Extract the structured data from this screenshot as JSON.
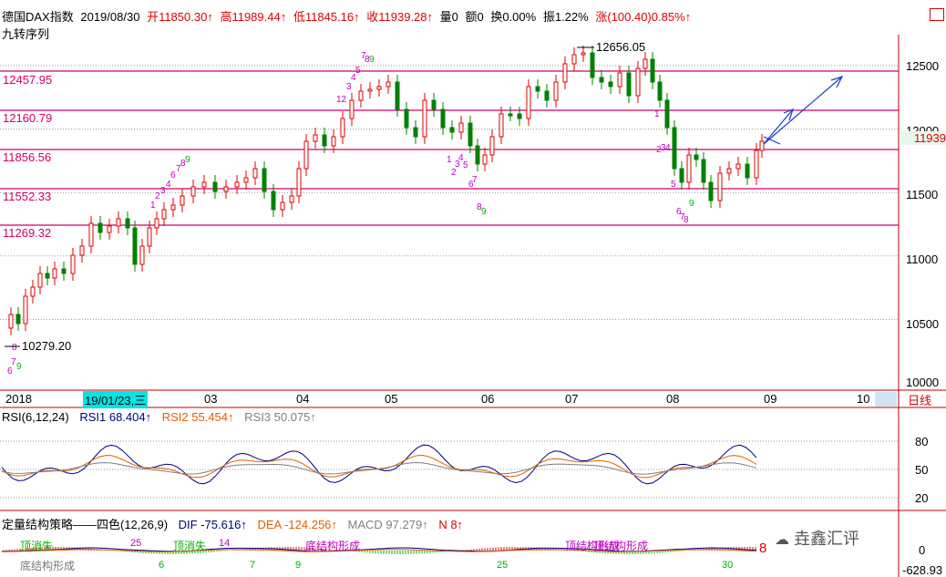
{
  "header": {
    "name": "德国DAX指数",
    "date": "2019/08/30",
    "open": "开11850.30↑",
    "high": "高11989.44↑",
    "low": "低11845.16↑",
    "close": "收11939.28↑",
    "vol": "量0",
    "amount": "额0",
    "turnover": "换0.00%",
    "amplitude": "振1.22%",
    "change": "涨(100.40)0.85%↑"
  },
  "subtitle": "九转序列",
  "level_labels": [
    "12457.95",
    "12160.79",
    "11856.56",
    "11552.33",
    "11269.32"
  ],
  "price_axis": [
    "12500",
    "12000",
    "11939",
    "11500",
    "11000",
    "10500",
    "10000"
  ],
  "annotations": {
    "high": "12656.05",
    "low": "10279.20"
  },
  "x_axis": [
    "2018",
    "03",
    "04",
    "05",
    "06",
    "07",
    "08",
    "09",
    "10"
  ],
  "cursor_date": "19/01/23,三",
  "period_button": "日线",
  "rsi": {
    "title": "RSI(6,12,24)",
    "rsi1": "RSI1 68.404↑",
    "rsi2": "RSI2 55.454↑",
    "rsi3": "RSI3 50.075↑",
    "axis": [
      "80",
      "50",
      "20"
    ]
  },
  "macd": {
    "title": "定量结构策略——四色(12,26,9)",
    "dif": "DIF -75.616↑",
    "dea": "DEA -124.256↑",
    "macd": "MACD 97.279↑",
    "n": "N 8↑",
    "axis": [
      "0",
      "-628.93"
    ],
    "labels": [
      "顶消失",
      "底结构形成",
      "顶消失",
      "底结构形成",
      "顶结构形成",
      "顶结构形成",
      "25",
      "6",
      "14",
      "7",
      "9",
      "25",
      "30",
      "8"
    ]
  },
  "watermark": "垚鑫汇评",
  "colors": {
    "up": "#e00000",
    "down": "#008000",
    "level": "#d0006a",
    "rsi1": "#000080",
    "rsi2": "#e06000",
    "rsi3": "#808080",
    "seq_up": "#c000c0",
    "seq_dn": "#00b000"
  }
}
